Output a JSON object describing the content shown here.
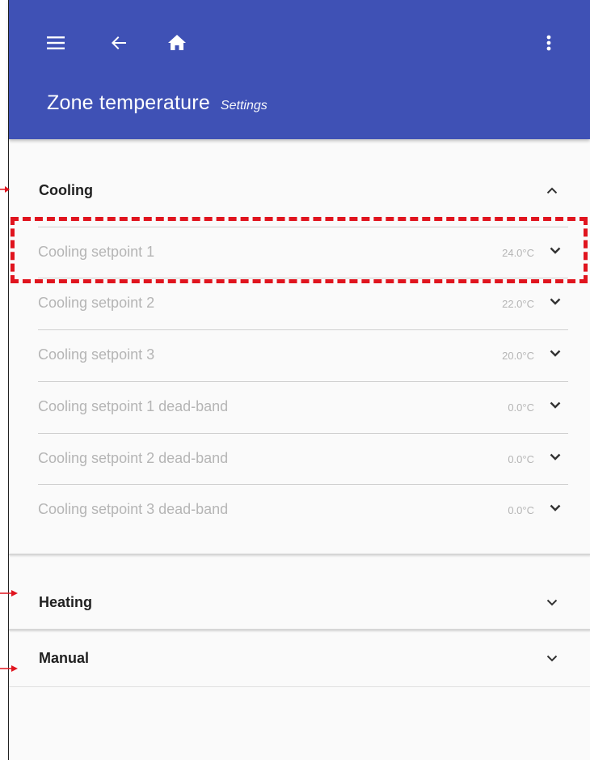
{
  "appbar": {
    "title": "Zone temperature",
    "subtitle": "Settings",
    "icons": [
      "menu-icon",
      "back-arrow-icon",
      "home-icon",
      "more-vert-icon"
    ],
    "color": "#3f51b5"
  },
  "sections": {
    "cooling": {
      "title": "Cooling",
      "expanded": true,
      "items": [
        {
          "label": "Cooling setpoint 1",
          "value": "24.0°C"
        },
        {
          "label": "Cooling setpoint 2",
          "value": "22.0°C"
        },
        {
          "label": "Cooling setpoint 3",
          "value": "20.0°C"
        },
        {
          "label": "Cooling setpoint 1 dead-band",
          "value": "0.0°C"
        },
        {
          "label": "Cooling setpoint 2 dead-band",
          "value": "0.0°C"
        },
        {
          "label": "Cooling setpoint 3 dead-band",
          "value": "0.0°C"
        }
      ]
    },
    "heating": {
      "title": "Heating",
      "expanded": false
    },
    "manual": {
      "title": "Manual",
      "expanded": false
    }
  },
  "annotation_color": "#e0141e"
}
